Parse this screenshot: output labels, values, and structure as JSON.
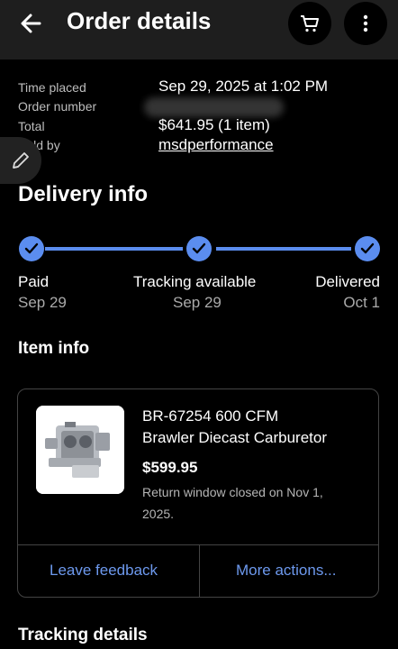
{
  "header": {
    "title": "Order details"
  },
  "order_meta": {
    "time_placed_label": "Time placed",
    "time_placed_value": "Sep 29, 2025 at 1:02 PM",
    "order_number_label": "Order number",
    "total_label": "Total",
    "total_value": "$641.95 (1 item)",
    "sold_by_label": "Sold by",
    "sold_by_value": "msdperformance"
  },
  "delivery": {
    "title": "Delivery info",
    "steps": [
      {
        "label": "Paid",
        "date": "Sep 29"
      },
      {
        "label": "Tracking available",
        "date": "Sep 29"
      },
      {
        "label": "Delivered",
        "date": "Oct 1"
      }
    ]
  },
  "item_info": {
    "title": "Item info",
    "name_line1": "BR-67254 600 CFM",
    "name_line2": "Brawler Diecast Carburetor",
    "price": "$599.95",
    "return_line1": "Return window closed on Nov 1,",
    "return_line2": "2025.",
    "actions": {
      "feedback": "Leave feedback",
      "more": "More actions..."
    }
  },
  "tracking": {
    "title": "Tracking details"
  },
  "colors": {
    "accent": "#5b8def",
    "link": "#6d99ee",
    "background": "#000000"
  }
}
